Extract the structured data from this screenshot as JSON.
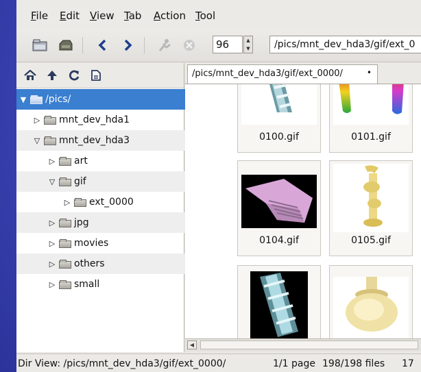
{
  "menubar": {
    "items": [
      "File",
      "Edit",
      "View",
      "Tab",
      "Action",
      "Tool"
    ]
  },
  "toolbar": {
    "zoom_value": "96",
    "path_value": "/pics/mnt_dev_hda3/gif/ext_0"
  },
  "tree": {
    "items": [
      {
        "label": "/pics/",
        "expander": "▼"
      },
      {
        "label": "mnt_dev_hda1",
        "expander": "▷"
      },
      {
        "label": "mnt_dev_hda3",
        "expander": "▽"
      },
      {
        "label": "art",
        "expander": "▷"
      },
      {
        "label": "gif",
        "expander": "▽"
      },
      {
        "label": "ext_0000",
        "expander": "▷"
      },
      {
        "label": "jpg",
        "expander": "▷"
      },
      {
        "label": "movies",
        "expander": "▷"
      },
      {
        "label": "others",
        "expander": "▷"
      },
      {
        "label": "small",
        "expander": "▷"
      }
    ]
  },
  "tab": {
    "label": "/pics/mnt_dev_hda3/gif/ext_0000/",
    "close": "•"
  },
  "thumbs": [
    {
      "label": "0100.gif"
    },
    {
      "label": "0101.gif"
    },
    {
      "label": "0104.gif"
    },
    {
      "label": "0105.gif"
    },
    {
      "label": ""
    },
    {
      "label": ""
    }
  ],
  "status": {
    "dir_view": "Dir View: /pics/mnt_dev_hda3/gif/ext_0000/",
    "page": "1/1 page",
    "files": "198/198 files",
    "extra": "17"
  },
  "colors": {
    "selection": "#3a7fd0",
    "desktop": "#3a42b2"
  }
}
